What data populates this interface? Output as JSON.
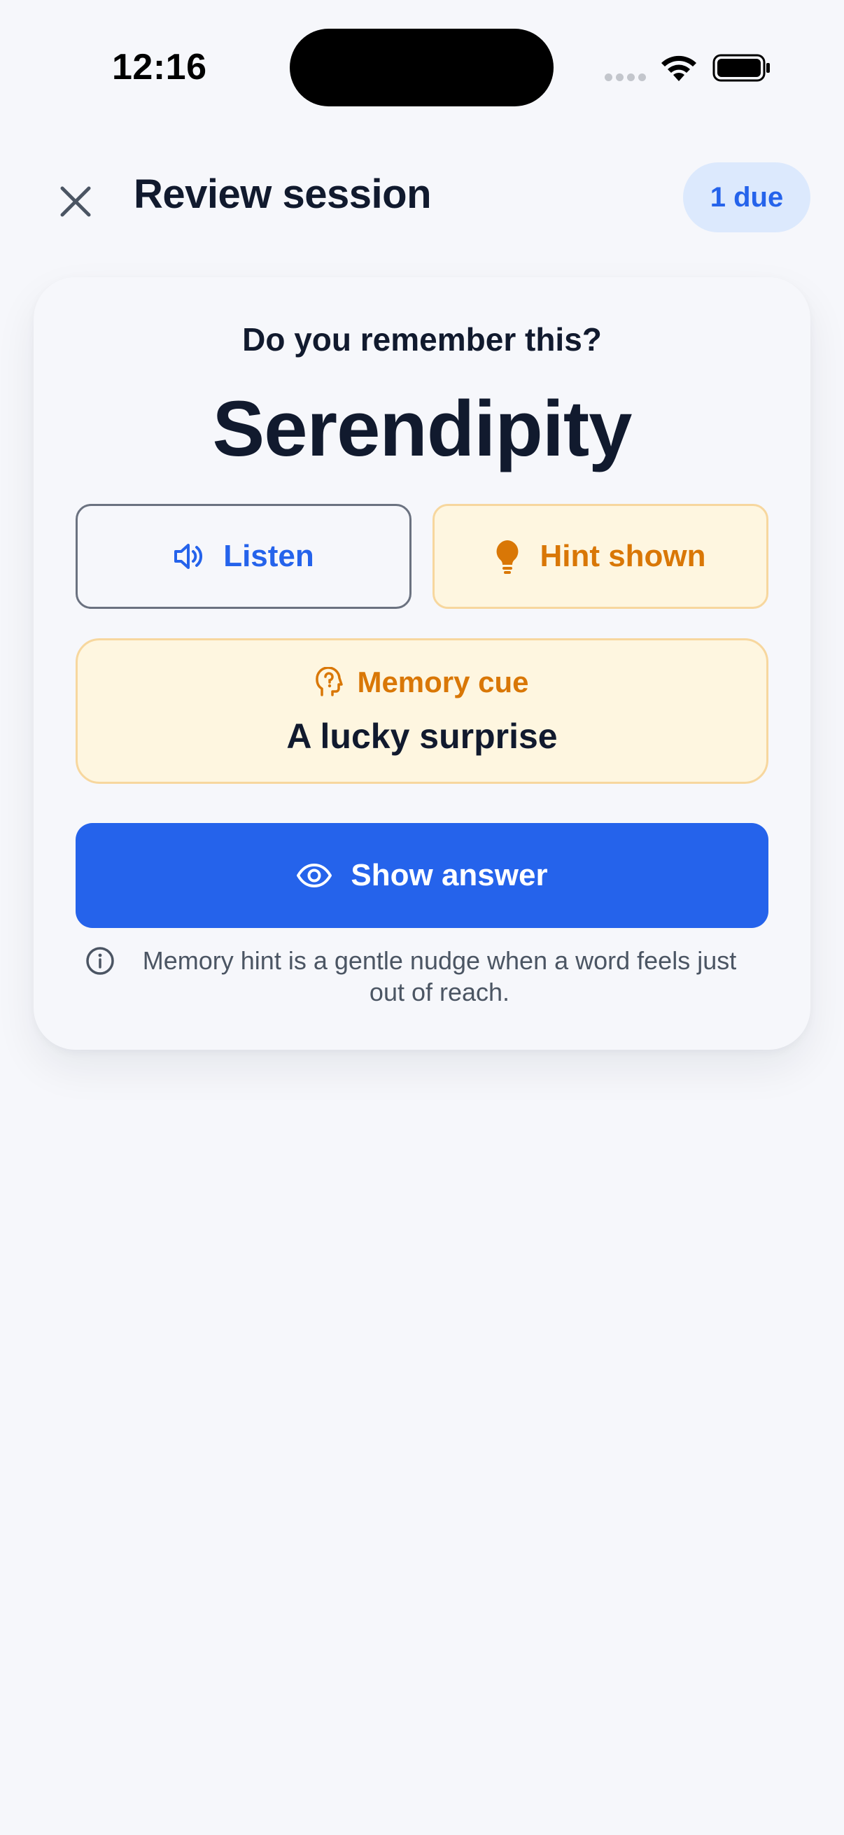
{
  "status_bar": {
    "time": "12:16",
    "icons": [
      "signal-dots-icon",
      "wifi-icon",
      "battery-icon"
    ]
  },
  "header": {
    "close_icon": "close-icon",
    "title": "Review session",
    "due_badge": "1 due"
  },
  "card": {
    "prompt": "Do you remember this?",
    "word": "Serendipity",
    "listen_button": {
      "label": "Listen",
      "icon": "speaker-icon"
    },
    "hint_button": {
      "label": "Hint shown",
      "icon": "lightbulb-icon"
    },
    "memory_cue": {
      "heading": "Memory cue",
      "icon": "head-question-icon",
      "text": "A lucky surprise"
    },
    "show_answer_button": {
      "label": "Show answer",
      "icon": "eye-icon"
    },
    "note": {
      "icon": "info-icon",
      "text": "Memory hint is a gentle nudge when a word feels just out of reach."
    }
  },
  "colors": {
    "background": "#f6f7fb",
    "primary": "#2563eb",
    "hint_accent": "#d97706",
    "hint_background": "#fef6e0",
    "badge_background": "#dce9fd",
    "text_dark": "#111a2e"
  }
}
